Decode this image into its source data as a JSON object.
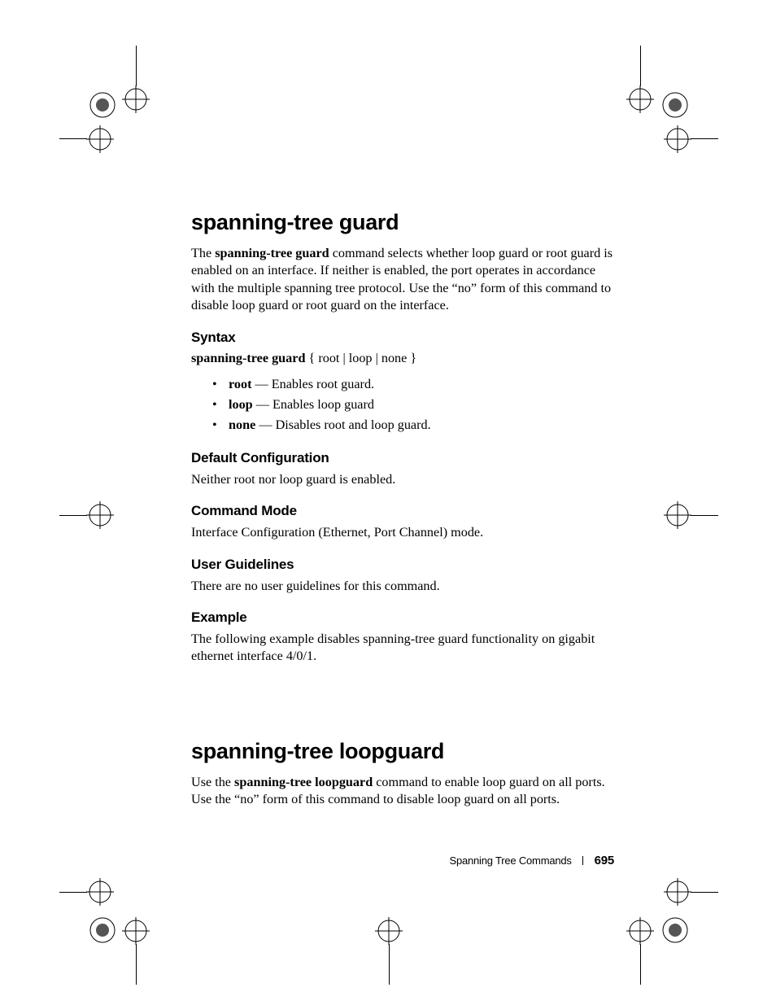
{
  "section1": {
    "title": "spanning-tree guard",
    "intro_pre": "The ",
    "intro_bold": "spanning-tree guard",
    "intro_post": " command selects whether loop guard or root guard is enabled on an interface. If neither is enabled, the port operates in accordance with the multiple spanning tree protocol. Use the “no” form of this command to disable loop guard or root guard on the interface.",
    "syntax": {
      "heading": "Syntax",
      "line_bold": "spanning-tree guard",
      "line_rest": " { root | loop | none }",
      "options": [
        {
          "name": "root",
          "desc": " — Enables root guard."
        },
        {
          "name": "loop",
          "desc": " — Enables loop guard"
        },
        {
          "name": "none",
          "desc": " — Disables root and loop guard."
        }
      ]
    },
    "defcfg": {
      "heading": "Default Configuration",
      "text": "Neither root nor loop guard is enabled."
    },
    "mode": {
      "heading": "Command Mode",
      "text": "Interface Configuration (Ethernet, Port Channel) mode."
    },
    "guidelines": {
      "heading": "User Guidelines",
      "text": "There are no user guidelines for this command."
    },
    "example": {
      "heading": "Example",
      "text": "The following example disables spanning-tree guard functionality on gigabit ethernet interface 4/0/1."
    }
  },
  "section2": {
    "title": "spanning-tree loopguard",
    "intro_pre": "Use the ",
    "intro_bold": "spanning-tree loopguard",
    "intro_post": " command to enable loop guard on all ports. Use the “no” form of this command to disable loop guard on all ports."
  },
  "footer": {
    "chapter": "Spanning Tree Commands",
    "page": "695"
  }
}
